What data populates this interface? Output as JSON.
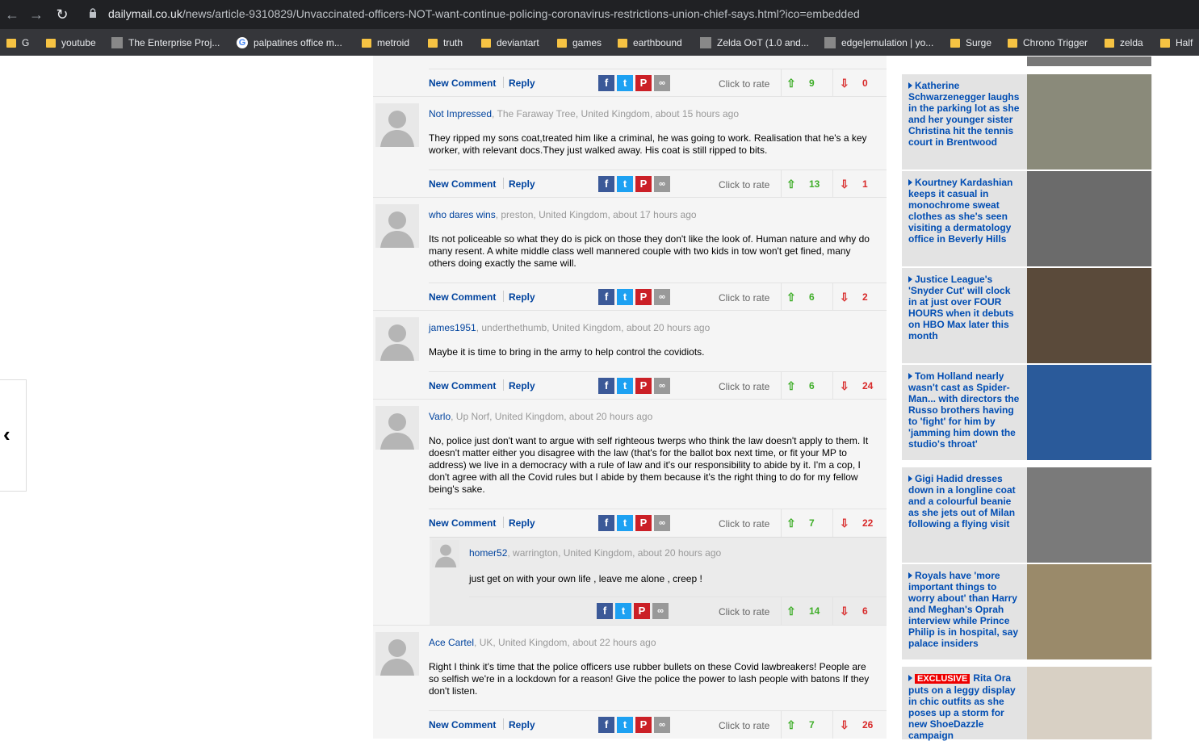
{
  "browser": {
    "url_host": "dailymail.co.uk",
    "url_path": "/news/article-9310829/Unvaccinated-officers-NOT-want-continue-policing-coronavirus-restrictions-union-chief-says.html?ico=embedded",
    "bookmarks": [
      {
        "label": "G",
        "icon": "folder"
      },
      {
        "label": "youtube",
        "icon": "folder"
      },
      {
        "label": "The Enterprise Proj...",
        "icon": "site-icon"
      },
      {
        "label": "palpatines office m...",
        "icon": "google-icon"
      },
      {
        "label": "metroid",
        "icon": "folder"
      },
      {
        "label": "truth",
        "icon": "folder"
      },
      {
        "label": "deviantart",
        "icon": "folder"
      },
      {
        "label": "games",
        "icon": "folder"
      },
      {
        "label": "earthbound",
        "icon": "folder"
      },
      {
        "label": "Zelda OoT (1.0 and...",
        "icon": "site-icon"
      },
      {
        "label": "edge|emulation | yo...",
        "icon": "site-icon"
      },
      {
        "label": "Surge",
        "icon": "folder"
      },
      {
        "label": "Chrono Trigger",
        "icon": "folder"
      },
      {
        "label": "zelda",
        "icon": "folder"
      },
      {
        "label": "Half",
        "icon": "folder"
      }
    ]
  },
  "comment_actions": {
    "new_comment": "New Comment",
    "reply": "Reply",
    "click_to_rate": "Click to rate"
  },
  "first_bar": {
    "up": "9",
    "down": "0"
  },
  "comments": [
    {
      "user": "Not Impressed",
      "location": ", The Faraway Tree, United Kingdom, about 15 hours ago",
      "text": "They ripped my sons coat,treated him like a criminal, he was going to work. Realisation that he's a key worker, with relevant docs.They just walked away. His coat is still ripped to bits.",
      "up": "13",
      "down": "1"
    },
    {
      "user": "who dares wins",
      "location": ", preston, United Kingdom, about 17 hours ago",
      "text": "Its not policeable so what they do is pick on those they don't like the look of. Human nature and why do many resent. A white middle class well mannered couple with two kids in tow won't get fined, many others doing exactly the same will.",
      "up": "6",
      "down": "2"
    },
    {
      "user": "james1951",
      "location": ", underthethumb, United Kingdom, about 20 hours ago",
      "text": "Maybe it is time to bring in the army to help control the covidiots.",
      "up": "6",
      "down": "24"
    },
    {
      "user": "Varlo",
      "location": ", Up Norf, United Kingdom, about 20 hours ago",
      "text": "No, police just don't want to argue with self righteous twerps who think the law doesn't apply to them. It doesn't matter either you disagree with the law (that's for the ballot box next time, or fit your MP to address) we live in a democracy with a rule of law and it's our responsibility to abide by it. I'm a cop, I don't agree with all the Covid rules but I abide by them because it's the right thing to do for my fellow being's sake.",
      "up": "7",
      "down": "22"
    },
    {
      "user": "Ace Cartel",
      "location": ", UK, United Kingdom, about 22 hours ago",
      "text": "Right I think it's time that the police officers use rubber bullets on these Covid lawbreakers! People are so selfish we're in a lockdown for a reason! Give the police the power to lash people with batons If they don't listen.",
      "up": "7",
      "down": "26"
    }
  ],
  "reply": {
    "user": "homer52",
    "location": ", warrington, United Kingdom, about 20 hours ago",
    "text": "just get on with your own life , leave me alone , creep !",
    "up": "14",
    "down": "6"
  },
  "sidebar": [
    {
      "headline": "Katherine Schwarzenegger laughs in the parking lot as she and her younger sister Christina hit the tennis court in Brentwood",
      "img_color": "#8a8a7a"
    },
    {
      "headline": "Kourtney Kardashian keeps it casual in monochrome sweat clothes as she's seen visiting a dermatology office in Beverly Hills",
      "img_color": "#6b6b6b"
    },
    {
      "headline": "Justice League's 'Snyder Cut' will clock in at just over FOUR HOURS when it debuts on HBO Max later this month",
      "img_color": "#5a4a3a"
    },
    {
      "headline": "Tom Holland nearly wasn't cast as Spider-Man... with directors the Russo brothers having to 'fight' for him by 'jamming him down the studio's throat'",
      "img_color": "#2a5a9a"
    },
    {
      "headline": "Gigi Hadid dresses down in a longline coat and a colourful beanie as she jets out of Milan following a flying visit",
      "img_color": "#7a7a7a"
    },
    {
      "headline": "Royals have 'more important things to worry about' than Harry and Meghan's Oprah interview while Prince Philip is in hospital, say palace insiders",
      "img_color": "#9a8a6a"
    },
    {
      "exclusive": "EXCLUSIVE",
      "headline": "Rita Ora puts on a leggy display in chic outfits as she poses up a storm for new ShoeDazzle campaign",
      "img_color": "#d8d0c4"
    }
  ]
}
